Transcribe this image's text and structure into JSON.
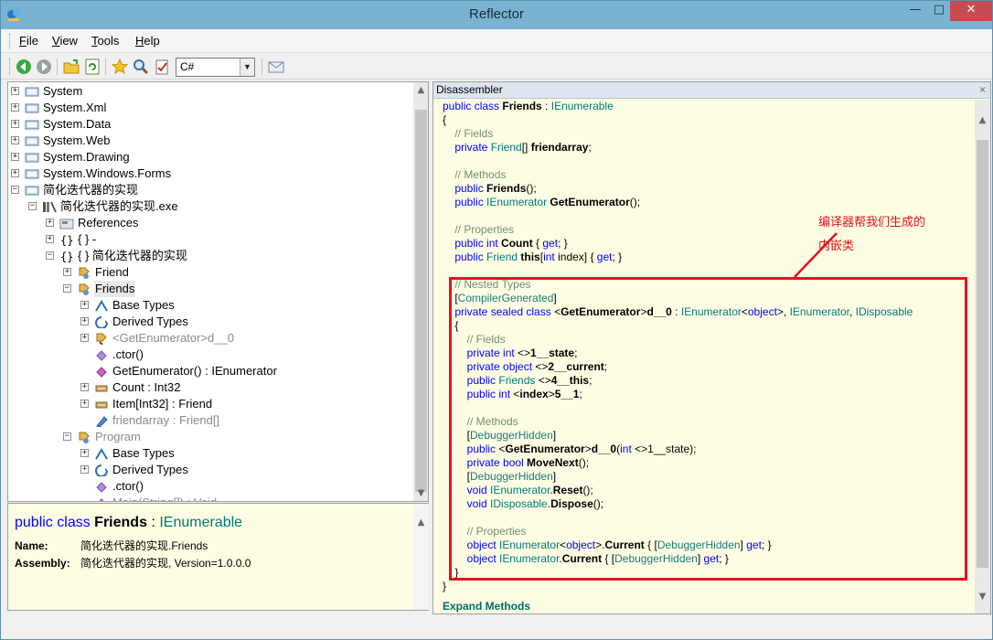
{
  "window": {
    "title": "Reflector",
    "controls": {
      "minimize": "—",
      "maximize": "□",
      "close": "✕"
    }
  },
  "menu": [
    {
      "label": "File",
      "u": "F",
      "rest": "ile"
    },
    {
      "label": "View",
      "u": "V",
      "rest": "iew"
    },
    {
      "label": "Tools",
      "u": "T",
      "rest": "ools"
    },
    {
      "label": "Help",
      "u": "H",
      "rest": "elp"
    }
  ],
  "toolbar": {
    "language": "C#",
    "icons": [
      "back-icon",
      "forward-icon",
      "open-icon",
      "refresh-icon",
      "bookmark-star-icon",
      "search-icon",
      "analyze-icon",
      "email-icon"
    ]
  },
  "tree": [
    {
      "label": "System",
      "expander": "+"
    },
    {
      "label": "System.Xml",
      "expander": "+"
    },
    {
      "label": "System.Data",
      "expander": "+"
    },
    {
      "label": "System.Web",
      "expander": "+"
    },
    {
      "label": "System.Drawing",
      "expander": "+"
    },
    {
      "label": "System.Windows.Forms",
      "expander": "+"
    },
    {
      "label": "简化迭代器的实现",
      "expander": "−"
    },
    {
      "label": "简化迭代器的实现.exe",
      "expander": "−"
    },
    {
      "label": "References",
      "expander": "+"
    },
    {
      "label": "{ } -",
      "expander": "+"
    },
    {
      "label": "{ } 简化迭代器的实现",
      "expander": "−"
    },
    {
      "label": "Friend",
      "expander": "+"
    },
    {
      "label": "Friends",
      "expander": "−"
    },
    {
      "label": "Base Types",
      "expander": "+"
    },
    {
      "label": "Derived Types",
      "expander": "+"
    },
    {
      "label": "<GetEnumerator>d__0",
      "expander": "+"
    },
    {
      "label": ".ctor()",
      "expander": ""
    },
    {
      "label": "GetEnumerator() : IEnumerator",
      "expander": ""
    },
    {
      "label": "Count : Int32",
      "expander": "+"
    },
    {
      "label": "Item[Int32] : Friend",
      "expander": "+"
    },
    {
      "label": "friendarray : Friend[]",
      "expander": ""
    },
    {
      "label": "Program",
      "expander": "−"
    },
    {
      "label": "Base Types",
      "expander": "+"
    },
    {
      "label": "Derived Types",
      "expander": "+"
    },
    {
      "label": ".ctor()",
      "expander": ""
    },
    {
      "label": "Main(String[]) : Void",
      "expander": ""
    }
  ],
  "info": {
    "kw_public": "public",
    "kw_class": "class",
    "class_name": "Friends",
    "colon": ":",
    "base": "IEnumerable",
    "name_label": "Name:",
    "name_value": "简化迭代器的实现.Friends",
    "assembly_label": "Assembly:",
    "assembly_value": "简化迭代器的实现, Version=1.0.0.0"
  },
  "disassembler": {
    "title": "Disassembler",
    "close": "×",
    "expand_methods": "Expand Methods"
  },
  "code": [
    [
      [
        "kw",
        "public class "
      ],
      [
        "id",
        "Friends"
      ],
      [
        "pl",
        " : "
      ],
      [
        "ty",
        "IEnumerable"
      ]
    ],
    [
      [
        "pl",
        "{"
      ]
    ],
    [
      [
        "cm",
        "    // Fields"
      ]
    ],
    [
      [
        "kw",
        "    private "
      ],
      [
        "ty",
        "Friend"
      ],
      [
        "pl",
        "[] "
      ],
      [
        "id",
        "friendarray"
      ],
      [
        "pl",
        ";"
      ]
    ],
    [],
    [
      [
        "cm",
        "    // Methods"
      ]
    ],
    [
      [
        "kw",
        "    public "
      ],
      [
        "id",
        "Friends"
      ],
      [
        "pl",
        "();"
      ]
    ],
    [
      [
        "kw",
        "    public "
      ],
      [
        "ty",
        "IEnumerator "
      ],
      [
        "id",
        "GetEnumerator"
      ],
      [
        "pl",
        "();"
      ]
    ],
    [],
    [
      [
        "cm",
        "    // Properties"
      ]
    ],
    [
      [
        "kw",
        "    public int "
      ],
      [
        "id",
        "Count"
      ],
      [
        "pl",
        " { "
      ],
      [
        "kw",
        "get"
      ],
      [
        "pl",
        "; }"
      ]
    ],
    [
      [
        "kw",
        "    public "
      ],
      [
        "ty",
        "Friend "
      ],
      [
        "id",
        "this"
      ],
      [
        "pl",
        "["
      ],
      [
        "kw",
        "int"
      ],
      [
        "pl",
        " index] { "
      ],
      [
        "kw",
        "get"
      ],
      [
        "pl",
        "; }"
      ]
    ],
    [],
    [
      [
        "cm",
        "    // Nested Types"
      ]
    ],
    [
      [
        "pl",
        "    ["
      ],
      [
        "at",
        "CompilerGenerated"
      ],
      [
        "pl",
        "]"
      ]
    ],
    [
      [
        "kw",
        "    private sealed class "
      ],
      [
        "pl",
        "<"
      ],
      [
        "id",
        "GetEnumerator"
      ],
      [
        "pl",
        ">"
      ],
      [
        "id",
        "d__0"
      ],
      [
        "pl",
        " : "
      ],
      [
        "ty",
        "IEnumerator"
      ],
      [
        "pl",
        "<"
      ],
      [
        "kw",
        "object"
      ],
      [
        "pl",
        ">, "
      ],
      [
        "ty",
        "IEnumerator"
      ],
      [
        "pl",
        ", "
      ],
      [
        "ty",
        "IDisposable"
      ]
    ],
    [
      [
        "pl",
        "    {"
      ]
    ],
    [
      [
        "cm",
        "        // Fields"
      ]
    ],
    [
      [
        "kw",
        "        private int "
      ],
      [
        "pl",
        "<>"
      ],
      [
        "id",
        "1__state"
      ],
      [
        "pl",
        ";"
      ]
    ],
    [
      [
        "kw",
        "        private object "
      ],
      [
        "pl",
        "<>"
      ],
      [
        "id",
        "2__current"
      ],
      [
        "pl",
        ";"
      ]
    ],
    [
      [
        "kw",
        "        public "
      ],
      [
        "ty",
        "Friends "
      ],
      [
        "pl",
        "<>"
      ],
      [
        "id",
        "4__this"
      ],
      [
        "pl",
        ";"
      ]
    ],
    [
      [
        "kw",
        "        public int "
      ],
      [
        "pl",
        "<"
      ],
      [
        "id",
        "index"
      ],
      [
        "pl",
        ">"
      ],
      [
        "id",
        "5__1"
      ],
      [
        "pl",
        ";"
      ]
    ],
    [],
    [
      [
        "cm",
        "        // Methods"
      ]
    ],
    [
      [
        "pl",
        "        ["
      ],
      [
        "at",
        "DebuggerHidden"
      ],
      [
        "pl",
        "]"
      ]
    ],
    [
      [
        "kw",
        "        public "
      ],
      [
        "pl",
        "<"
      ],
      [
        "id",
        "GetEnumerator"
      ],
      [
        "pl",
        ">"
      ],
      [
        "id",
        "d__0"
      ],
      [
        "pl",
        "("
      ],
      [
        "kw",
        "int"
      ],
      [
        "pl",
        " <>1__state);"
      ]
    ],
    [
      [
        "kw",
        "        private bool "
      ],
      [
        "id",
        "MoveNext"
      ],
      [
        "pl",
        "();"
      ]
    ],
    [
      [
        "pl",
        "        ["
      ],
      [
        "at",
        "DebuggerHidden"
      ],
      [
        "pl",
        "]"
      ]
    ],
    [
      [
        "kw",
        "        void "
      ],
      [
        "ty",
        "IEnumerator"
      ],
      [
        "pl",
        "."
      ],
      [
        "id",
        "Reset"
      ],
      [
        "pl",
        "();"
      ]
    ],
    [
      [
        "kw",
        "        void "
      ],
      [
        "ty",
        "IDisposable"
      ],
      [
        "pl",
        "."
      ],
      [
        "id",
        "Dispose"
      ],
      [
        "pl",
        "();"
      ]
    ],
    [],
    [
      [
        "cm",
        "        // Properties"
      ]
    ],
    [
      [
        "kw",
        "        object "
      ],
      [
        "ty",
        "IEnumerator"
      ],
      [
        "pl",
        "<"
      ],
      [
        "kw",
        "object"
      ],
      [
        "pl",
        ">."
      ],
      [
        "id",
        "Current"
      ],
      [
        "pl",
        " { ["
      ],
      [
        "at",
        "DebuggerHidden"
      ],
      [
        "pl",
        "] "
      ],
      [
        "kw",
        "get"
      ],
      [
        "pl",
        "; }"
      ]
    ],
    [
      [
        "kw",
        "        object "
      ],
      [
        "ty",
        "IEnumerator"
      ],
      [
        "pl",
        "."
      ],
      [
        "id",
        "Current"
      ],
      [
        "pl",
        " { ["
      ],
      [
        "at",
        "DebuggerHidden"
      ],
      [
        "pl",
        "] "
      ],
      [
        "kw",
        "get"
      ],
      [
        "pl",
        "; }"
      ]
    ],
    [
      [
        "pl",
        "    }"
      ]
    ],
    [
      [
        "pl",
        "}"
      ]
    ]
  ],
  "annotation": {
    "line1": "编译器帮我们生成的",
    "line2": "内嵌类"
  }
}
